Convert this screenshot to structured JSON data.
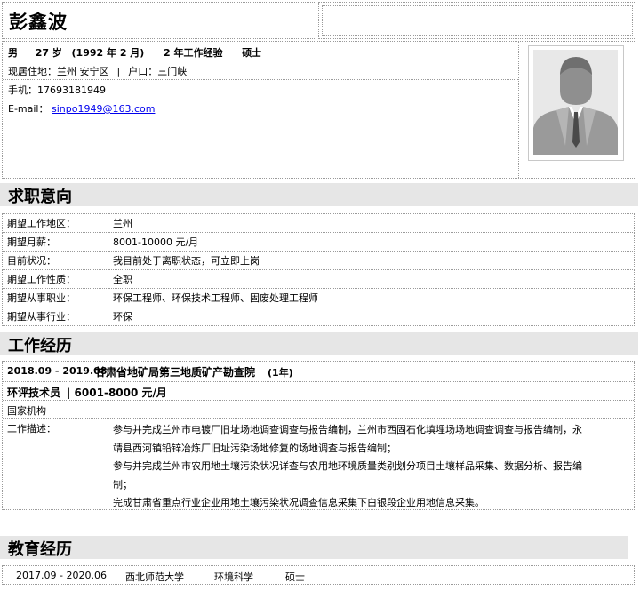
{
  "header": {
    "name": "彭鑫波",
    "gender": "男",
    "age": "27 岁",
    "birth": "(1992 年 2 月)",
    "experience": "2 年工作经验",
    "degree": "硕士",
    "residence_label": "现居住地：",
    "residence": "兰州 安宁区",
    "divider": "|",
    "hukou_label": "户口：",
    "hukou": "三门峡",
    "phone_label": "手机：",
    "phone": "17693181949",
    "email_label": "E-mail：",
    "email": "sinpo1949@163.com",
    "avatar_icon": "person-silhouette-icon"
  },
  "intention": {
    "title": "求职意向",
    "rows": [
      {
        "label": "期望工作地区：",
        "value": "兰州"
      },
      {
        "label": "期望月薪：",
        "value": "8001-10000 元/月"
      },
      {
        "label": "目前状况：",
        "value": "我目前处于离职状态，可立即上岗"
      },
      {
        "label": "期望工作性质：",
        "value": "全职"
      },
      {
        "label": "期望从事职业：",
        "value": "环保工程师、环保技术工程师、固废处理工程师"
      },
      {
        "label": "期望从事行业：",
        "value": "环保"
      }
    ]
  },
  "work": {
    "title": "工作经历",
    "period": "2018.09 - 2019.08",
    "company": "甘肃省地矿局第三地质矿产勘查院",
    "duration": "(1年)",
    "position": "环评技术员",
    "salary": "| 6001-8000 元/月",
    "company_type": "国家机构",
    "desc_label": "工作描述：",
    "desc_lines": [
      "参与并完成兰州市电镀厂旧址场地调查调查与报告编制，兰州市西固石化填埋场场地调查调查与报告编制，永",
      "靖县西河镇铅锌冶炼厂旧址污染场地修复的场地调查与报告编制；",
      "参与并完成兰州市农用地土壤污染状况详查与农用地环境质量类别划分项目土壤样品采集、数据分析、报告编",
      "制；",
      "完成甘肃省重点行业企业用地土壤污染状况调查信息采集下白银段企业用地信息采集。"
    ]
  },
  "education": {
    "title": "教育经历",
    "period": "2017.09 - 2020.06",
    "school": "西北师范大学",
    "major": "环境科学",
    "degree": "硕士"
  }
}
